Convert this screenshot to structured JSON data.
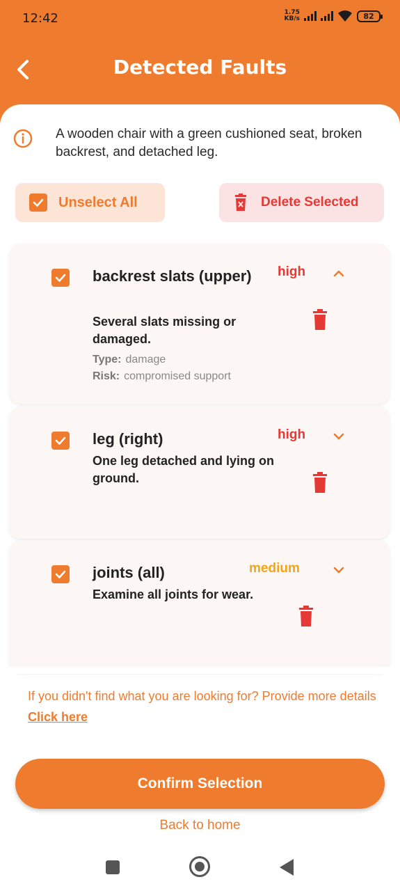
{
  "status_bar": {
    "time": "12:42",
    "net_speed_value": "1.75",
    "net_speed_unit": "KB/s",
    "battery": "82"
  },
  "header": {
    "title": "Detected Faults",
    "back_icon": "chevron-left-icon",
    "bg_color": "#EE7B2E"
  },
  "info": {
    "icon": "info-icon",
    "text": "A wooden chair with a green cushioned seat, broken backrest, and detached leg."
  },
  "actions": {
    "unselect_all_label": "Unselect All",
    "delete_selected_label": "Delete Selected"
  },
  "faults": [
    {
      "title": "backrest slats (upper)",
      "severity": "high",
      "description": "Several slats missing or damaged.",
      "type_label": "Type:",
      "type_value": "damage",
      "risk_label": "Risk:",
      "risk_value": "compromised support",
      "checked": true,
      "expanded": true
    },
    {
      "title": "leg (right)",
      "severity": "high",
      "description": "One leg detached and lying on ground.",
      "checked": true,
      "expanded": false
    },
    {
      "title": "joints (all)",
      "severity": "medium",
      "description": "Examine all joints for wear.",
      "checked": true,
      "expanded": false
    }
  ],
  "hint": {
    "text": "If you didn't find what you are looking for? Provide more details ",
    "link": "Click here"
  },
  "confirm_label": "Confirm Selection",
  "back_home_label": "Back to home",
  "colors": {
    "accent": "#EE7B2E",
    "danger": "#E53935",
    "medium": "#F2A516"
  }
}
